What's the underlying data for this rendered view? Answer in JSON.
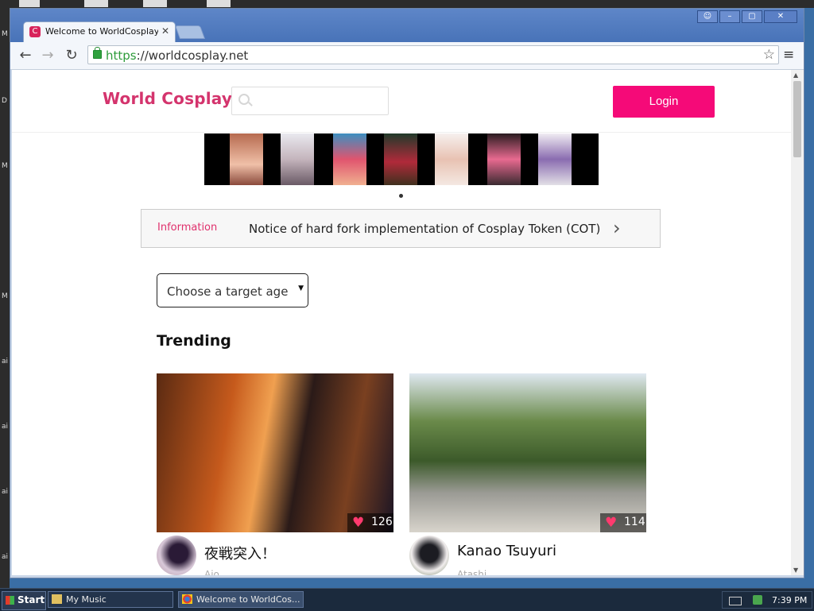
{
  "desktop": {
    "left_letters": [
      "M",
      "D",
      "M",
      "M",
      "ai",
      "ai",
      "ai",
      "ai"
    ]
  },
  "browser": {
    "tab_title": "Welcome to WorldCosplay - W",
    "tab_favicon_letter": "C",
    "url_scheme": "https",
    "url_rest": "://worldcosplay.net"
  },
  "page": {
    "logo": "World Cosplay",
    "search_placeholder": "",
    "login_label": "Login",
    "info": {
      "label": "Information",
      "text": "Notice of hard fork implementation of Cosplay Token (COT)"
    },
    "age_select": {
      "selected": "Choose a target age"
    },
    "trending_heading": "Trending",
    "cards": [
      {
        "title": "夜戦突入！",
        "author": "Aio",
        "likes": "126"
      },
      {
        "title": "Kanao Tsuyuri",
        "author": "Atashi",
        "likes": "114"
      }
    ]
  },
  "taskbar": {
    "start_label": "Start",
    "buttons": [
      {
        "label": "My Music"
      },
      {
        "label": "Welcome to WorldCos..."
      }
    ],
    "clock": "7:39 PM"
  },
  "colors": {
    "brand_pink": "#d4346d",
    "login_pink": "#f50a78",
    "info_label": "#e0306c"
  }
}
